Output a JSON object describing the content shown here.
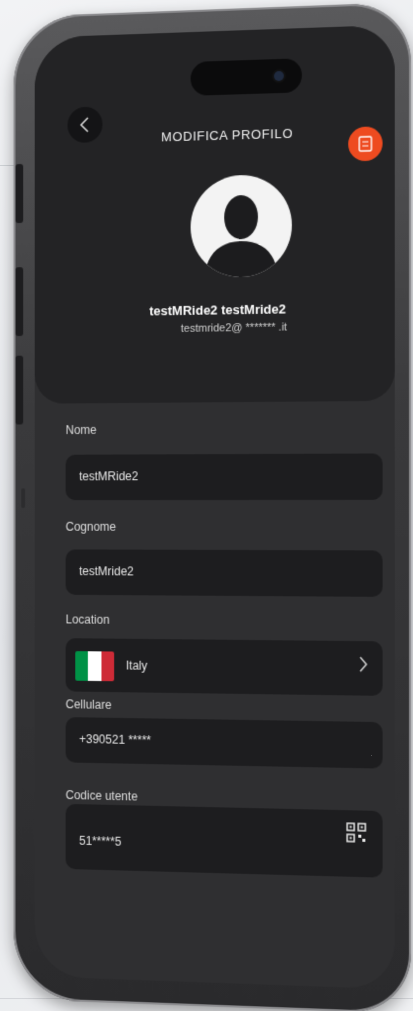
{
  "header": {
    "title": "MODIFICA PROFILO",
    "back_icon": "chevron-left-icon",
    "save_icon": "save-icon",
    "accent_color": "#ee4b20"
  },
  "profile": {
    "full_name": "testMRide2 testMride2",
    "email": "testmride2@ ******* .it"
  },
  "fields": {
    "nome": {
      "label": "Nome",
      "value": "testMRide2"
    },
    "cognome": {
      "label": "Cognome",
      "value": "testMride2"
    },
    "location": {
      "label": "Location",
      "value": "Italy",
      "flag_colors": [
        "#009246",
        "#ffffff",
        "#ce2b37"
      ]
    },
    "cellulare": {
      "label": "Cellulare",
      "value": "+390521 *****"
    },
    "codice_utente": {
      "label": "Codice utente",
      "value": "51*****5",
      "icon": "qr-code-icon"
    }
  }
}
